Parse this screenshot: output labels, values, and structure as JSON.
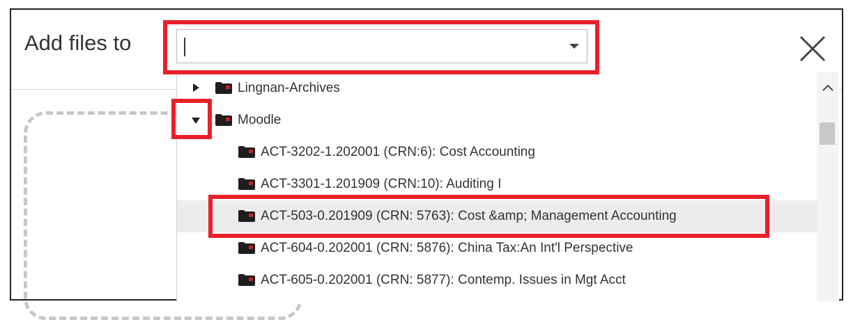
{
  "dialog": {
    "title": "Add files to",
    "close_icon": "close-icon"
  },
  "combo": {
    "value": "",
    "arrow_icon": "chevron-down-icon"
  },
  "tree": {
    "items": [
      {
        "label": "Lingnan-Archives",
        "expander": "collapsed",
        "icon": "folder-icon"
      },
      {
        "label": "Moodle",
        "expander": "expanded",
        "icon": "folder-icon"
      },
      {
        "label": "ACT-3202-1.202001 (CRN:6): Cost Accounting",
        "icon": "folder-icon"
      },
      {
        "label": "ACT-3301-1.201909 (CRN:10): Auditing I",
        "icon": "folder-icon"
      },
      {
        "label": "ACT-503-0.201909 (CRN: 5763): Cost &amp; Management Accounting",
        "icon": "folder-icon",
        "selected": true
      },
      {
        "label": "ACT-604-0.202001 (CRN: 5876): China Tax:An Int'l Perspective",
        "icon": "folder-icon"
      },
      {
        "label": "ACT-605-0.202001 (CRN: 5877): Contemp. Issues in Mgt Acct",
        "icon": "folder-icon"
      }
    ]
  },
  "colors": {
    "highlight": "#e8202a",
    "folder": "#1e1e1e",
    "folder_badge": "#d42020",
    "selected_row": "#ececec"
  }
}
